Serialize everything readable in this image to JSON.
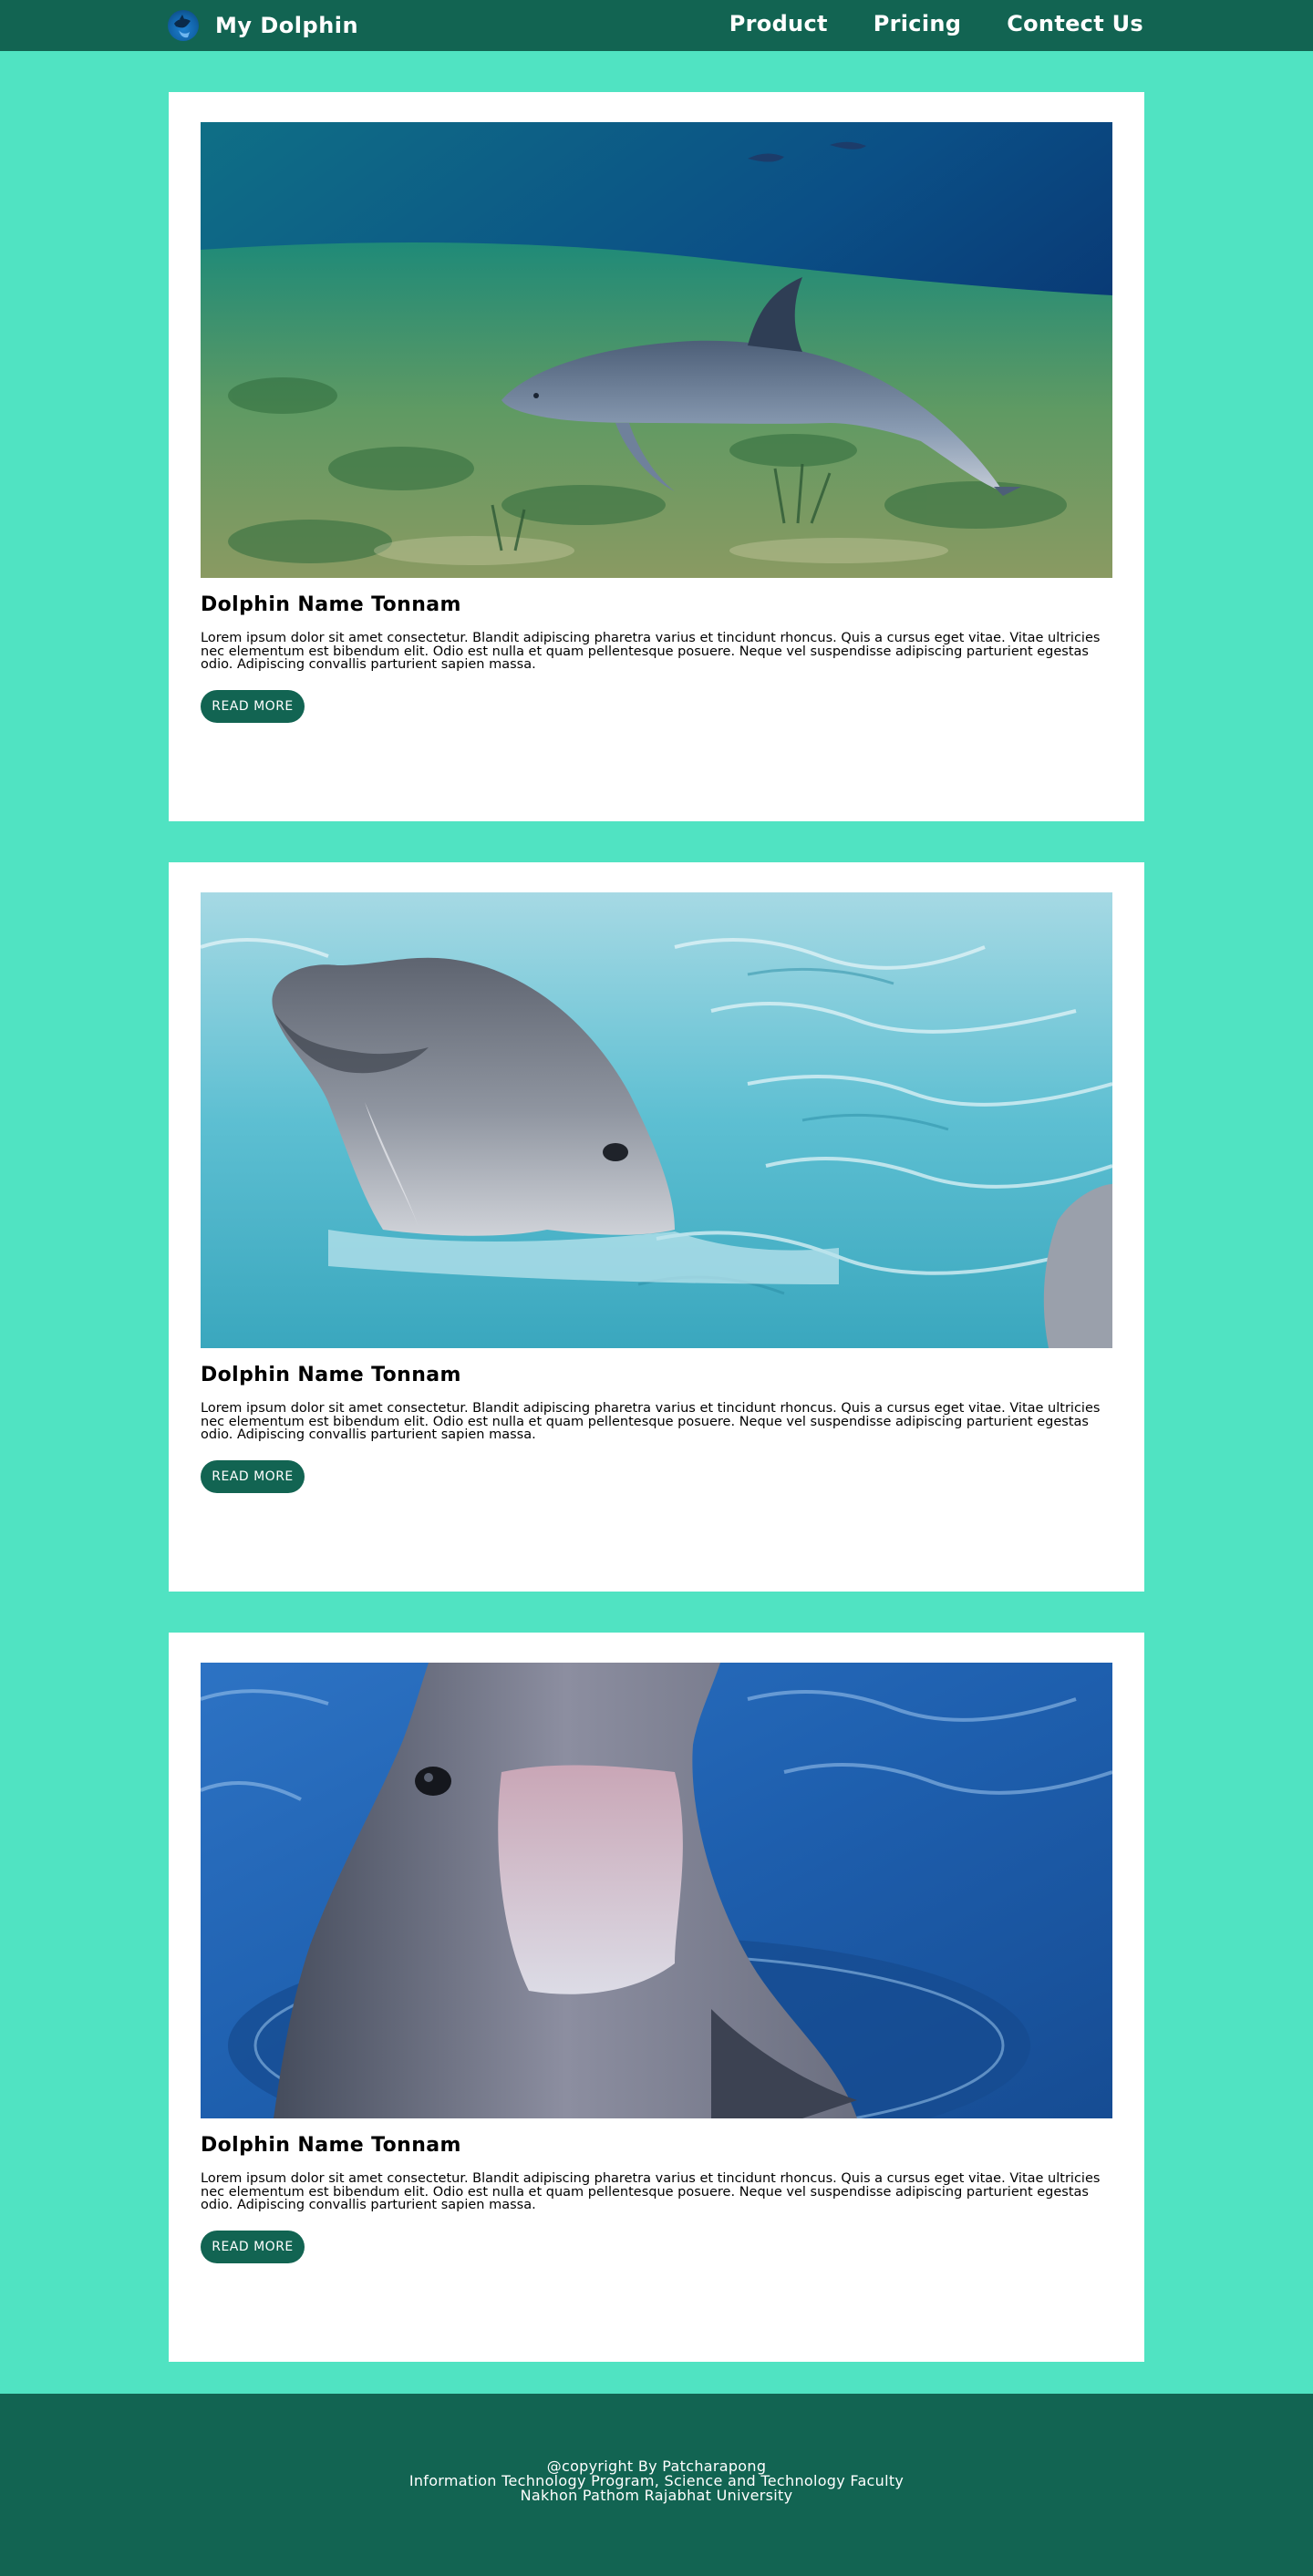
{
  "header": {
    "brand": "My Dolphin",
    "nav": [
      "Product",
      "Pricing",
      "Contect Us"
    ]
  },
  "cards": [
    {
      "image": "dolphin-swimming-over-seagrass",
      "title": "Dolphin Name Tonnam",
      "text": "Lorem ipsum dolor sit amet consectetur. Blandit adipiscing pharetra varius et tincidunt rhoncus. Quis a cursus eget vitae. Vitae ultricies nec elementum est bibendum elit. Odio est nulla et quam pellentesque posuere. Neque vel suspendisse adipiscing parturient egestas odio. Adipiscing convallis parturient sapien massa.",
      "button": "READ MORE"
    },
    {
      "image": "dolphin-head-in-turquoise-water",
      "title": "Dolphin Name Tonnam",
      "text": "Lorem ipsum dolor sit amet consectetur. Blandit adipiscing pharetra varius et tincidunt rhoncus. Quis a cursus eget vitae. Vitae ultricies nec elementum est bibendum elit. Odio est nulla et quam pellentesque posuere. Neque vel suspendisse adipiscing parturient egestas odio. Adipiscing convallis parturient sapien massa.",
      "button": "READ MORE"
    },
    {
      "image": "dolphin-rising-from-blue-water",
      "title": "Dolphin Name Tonnam",
      "text": "Lorem ipsum dolor sit amet consectetur. Blandit adipiscing pharetra varius et tincidunt rhoncus. Quis a cursus eget vitae. Vitae ultricies nec elementum est bibendum elit. Odio est nulla et quam pellentesque posuere. Neque vel suspendisse adipiscing parturient egestas odio. Adipiscing convallis parturient sapien massa.",
      "button": "READ MORE"
    }
  ],
  "footer": {
    "lines": [
      "@copyright By Patcharapong",
      "Information Technology Program, Science and Technology Faculty",
      "Nakhon Pathom Rajabhat University"
    ]
  },
  "colors": {
    "page_background": "#50e3c2",
    "header_footer": "#126452",
    "card": "#ffffff",
    "button": "#126452"
  }
}
